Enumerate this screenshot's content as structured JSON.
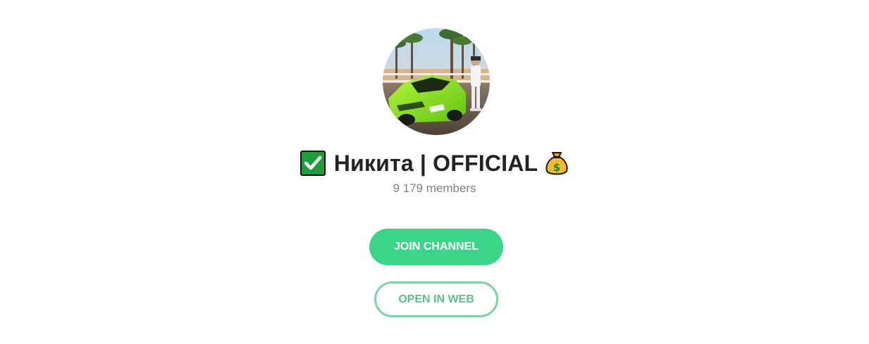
{
  "channel": {
    "title": "Никита | OFFICIAL",
    "members": "9 179 members",
    "title_prefix_icon": "check-mark-emoji",
    "title_suffix_icon": "money-bag-emoji"
  },
  "actions": {
    "join_label": "JOIN CHANNEL",
    "open_web_label": "OPEN IN WEB"
  },
  "colors": {
    "accent": "#3ad589",
    "outline": "#7cd1a6",
    "title": "#222222",
    "subtitle": "#808080"
  }
}
